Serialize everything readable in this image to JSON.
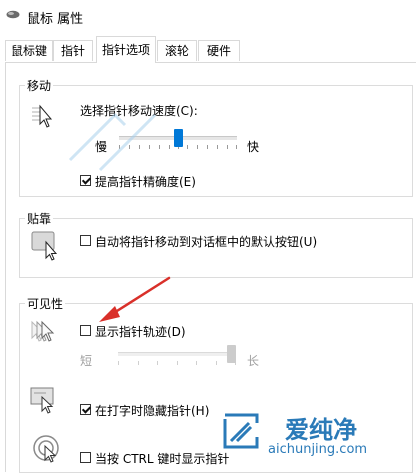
{
  "window": {
    "title": "鼠标 属性"
  },
  "tabs": [
    {
      "label": "鼠标键"
    },
    {
      "label": "指针"
    },
    {
      "label": "指针选项"
    },
    {
      "label": "滚轮"
    },
    {
      "label": "硬件"
    }
  ],
  "motion": {
    "heading": "移动",
    "speed_label": "选择指针移动速度(C):",
    "slow_label": "慢",
    "fast_label": "快",
    "speed_level": 0.5,
    "precision_label": "提高指针精确度(E)",
    "precision_checked": true
  },
  "snap": {
    "heading": "贴靠",
    "snap_label": "自动将指针移动到对话框中的默认按钮(U)",
    "snap_checked": false
  },
  "visibility": {
    "heading": "可见性",
    "trails_label": "显示指针轨迹(D)",
    "trails_checked": false,
    "short_label": "短",
    "long_label": "长",
    "trail_level": 1.0,
    "hide_typing_label": "在打字时隐藏指针(H)",
    "hide_typing_checked": true,
    "ctrl_label": "当按 CTRL 键时显示指针",
    "ctrl_checked": false
  },
  "watermark": {
    "brand": "爱纯净",
    "url": "aichunjing.com"
  },
  "colors": {
    "accent": "#0078d7",
    "annotation_arrow": "#d9302a",
    "watermark": "#2a7ab8"
  }
}
